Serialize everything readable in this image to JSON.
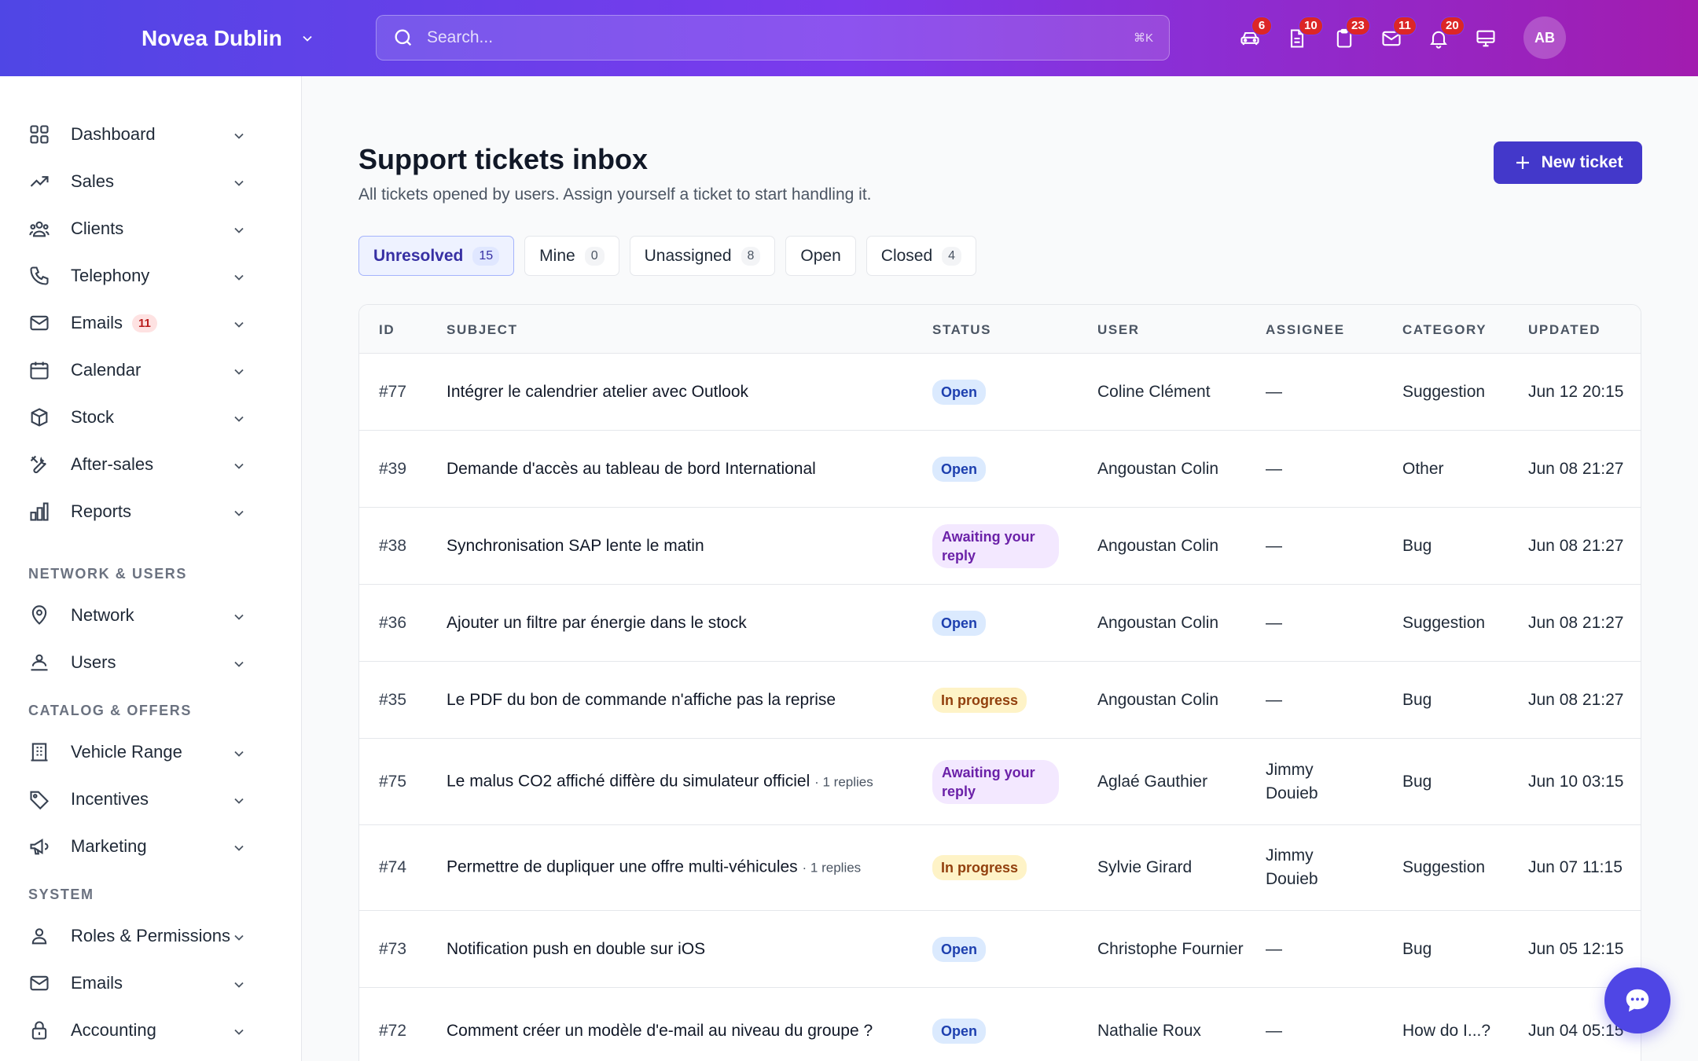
{
  "header": {
    "brand": "Novea Dublin",
    "search_placeholder": "Search...",
    "search_shortcut": "⌘K",
    "icons": [
      {
        "name": "car-icon",
        "badge": "6"
      },
      {
        "name": "document-icon",
        "badge": "10"
      },
      {
        "name": "clipboard-icon",
        "badge": "23"
      },
      {
        "name": "mail-icon",
        "badge": "11"
      },
      {
        "name": "bell-icon",
        "badge": "20"
      },
      {
        "name": "monitor-icon",
        "badge": ""
      }
    ],
    "avatar": "AB"
  },
  "sidebar": {
    "main": [
      {
        "label": "Dashboard",
        "icon": "grid-icon"
      },
      {
        "label": "Sales",
        "icon": "trending-up-icon"
      },
      {
        "label": "Clients",
        "icon": "users-icon"
      },
      {
        "label": "Telephony",
        "icon": "phone-icon"
      },
      {
        "label": "Emails",
        "icon": "mail-icon",
        "badge": "11"
      },
      {
        "label": "Calendar",
        "icon": "calendar-icon"
      },
      {
        "label": "Stock",
        "icon": "box-icon"
      },
      {
        "label": "After-sales",
        "icon": "wrench-icon"
      },
      {
        "label": "Reports",
        "icon": "bar-chart-icon"
      }
    ],
    "section_network": "NETWORK & USERS",
    "network": [
      {
        "label": "Network",
        "icon": "map-pin-icon"
      },
      {
        "label": "Users",
        "icon": "user-group-icon"
      }
    ],
    "section_catalog": "CATALOG & OFFERS",
    "catalog": [
      {
        "label": "Vehicle Range",
        "icon": "building-icon"
      },
      {
        "label": "Incentives",
        "icon": "tag-icon"
      },
      {
        "label": "Marketing",
        "icon": "megaphone-icon"
      }
    ],
    "section_system": "SYSTEM",
    "system": [
      {
        "label": "Roles & Permissions",
        "icon": "user-icon"
      },
      {
        "label": "Emails",
        "icon": "mail-icon"
      },
      {
        "label": "Accounting",
        "icon": "lock-icon"
      }
    ]
  },
  "main": {
    "title": "Support tickets inbox",
    "subtitle": "All tickets opened by users. Assign yourself a ticket to start handling it.",
    "new_button": "New ticket",
    "tabs": [
      {
        "label": "Unresolved",
        "count": "15",
        "active": true
      },
      {
        "label": "Mine",
        "count": "0"
      },
      {
        "label": "Unassigned",
        "count": "8"
      },
      {
        "label": "Open",
        "count": ""
      },
      {
        "label": "Closed",
        "count": "4"
      }
    ],
    "columns": [
      "ID",
      "SUBJECT",
      "STATUS",
      "USER",
      "ASSIGNEE",
      "CATEGORY",
      "UPDATED"
    ],
    "rows": [
      {
        "id": "#77",
        "subject": "Intégrer le calendrier atelier avec Outlook",
        "replies": "",
        "status": "Open",
        "status_type": "open",
        "user": "Coline Clément",
        "assignee": "—",
        "category": "Suggestion",
        "updated": "Jun 12 20:15"
      },
      {
        "id": "#39",
        "subject": "Demande d'accès au tableau de bord International",
        "replies": "",
        "status": "Open",
        "status_type": "open",
        "user": "Angoustan Colin",
        "assignee": "—",
        "category": "Other",
        "updated": "Jun 08 21:27"
      },
      {
        "id": "#38",
        "subject": "Synchronisation SAP lente le matin",
        "replies": "",
        "status": "Awaiting your reply",
        "status_type": "await",
        "user": "Angoustan Colin",
        "assignee": "—",
        "category": "Bug",
        "updated": "Jun 08 21:27"
      },
      {
        "id": "#36",
        "subject": "Ajouter un filtre par énergie dans le stock",
        "replies": "",
        "status": "Open",
        "status_type": "open",
        "user": "Angoustan Colin",
        "assignee": "—",
        "category": "Suggestion",
        "updated": "Jun 08 21:27"
      },
      {
        "id": "#35",
        "subject": "Le PDF du bon de commande n'affiche pas la reprise",
        "replies": "",
        "status": "In progress",
        "status_type": "prog",
        "user": "Angoustan Colin",
        "assignee": "—",
        "category": "Bug",
        "updated": "Jun 08 21:27"
      },
      {
        "id": "#75",
        "subject": "Le malus CO2 affiché diffère du simulateur officiel",
        "replies": "· 1 replies",
        "status": "Awaiting your reply",
        "status_type": "await",
        "user": "Aglaé Gauthier",
        "assignee": "Jimmy Douieb",
        "category": "Bug",
        "updated": "Jun 10 03:15"
      },
      {
        "id": "#74",
        "subject": "Permettre de dupliquer une offre multi-véhicules",
        "replies": "· 1 replies",
        "status": "In progress",
        "status_type": "prog",
        "user": "Sylvie Girard",
        "assignee": "Jimmy Douieb",
        "category": "Suggestion",
        "updated": "Jun 07 11:15"
      },
      {
        "id": "#73",
        "subject": "Notification push en double sur iOS",
        "replies": "",
        "status": "Open",
        "status_type": "open",
        "user": "Christophe Fournier",
        "assignee": "—",
        "category": "Bug",
        "updated": "Jun 05 12:15"
      },
      {
        "id": "#72",
        "subject": "Comment créer un modèle d'e-mail au niveau du groupe ?",
        "replies": "",
        "status": "Open",
        "status_type": "open",
        "user": "Nathalie Roux",
        "assignee": "—",
        "category": "How do I...?",
        "updated": "Jun 04 05:15"
      }
    ]
  },
  "colors": {
    "accent": "#4338ca",
    "topbar_from": "#4f46e5",
    "topbar_to": "#a21caf"
  }
}
